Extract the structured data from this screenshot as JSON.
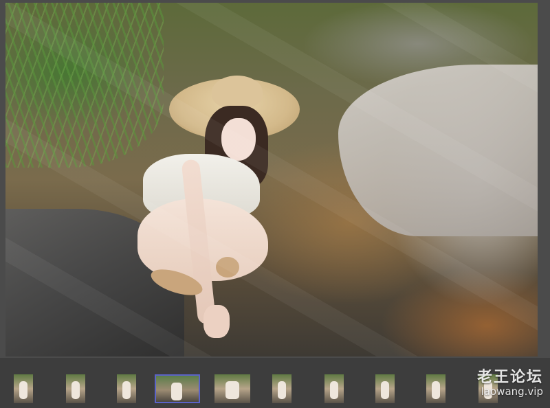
{
  "viewer": {
    "thumbnail_count": 10,
    "selected_index": 3
  },
  "brand": {
    "title": "老王论坛",
    "url": "laowang.vip"
  }
}
